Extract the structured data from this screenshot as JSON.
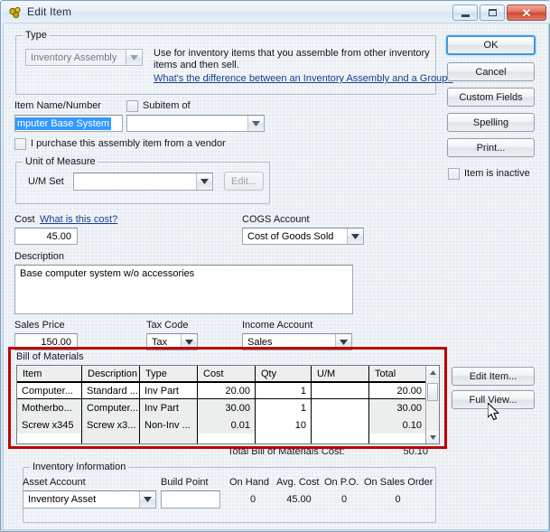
{
  "window": {
    "title": "Edit Item",
    "icon": "item-assembly-icon",
    "controls": {
      "minimize": "minimize-button",
      "maximize": "maximize-button",
      "close": "close-button",
      "close_glyph": "✕"
    }
  },
  "colors": {
    "annotation": "#c00000",
    "link": "#1a3c8c",
    "selection": "#3399ff",
    "dialog_bg": "#e8edf2"
  },
  "type_group": {
    "title": "Type",
    "selected": "Inventory Assembly",
    "help_text": "Use for inventory items that you assemble from other inventory items and then sell.",
    "link_text": "What's the difference between an Inventory Assembly and a Group?"
  },
  "item_name": {
    "label": "Item Name/Number",
    "value": "mputer Base System",
    "subitem_label": "Subitem of",
    "subitem_checked": false,
    "subitem_value": ""
  },
  "purchase_from_vendor": {
    "label": "I purchase this assembly item from a vendor",
    "checked": false
  },
  "unit_of_measure": {
    "title": "Unit of Measure",
    "label": "U/M Set",
    "value": "",
    "edit_button": "Edit..."
  },
  "cost": {
    "label": "Cost",
    "link_text": "What is this cost?",
    "value": "45.00"
  },
  "cogs": {
    "label": "COGS Account",
    "value": "Cost of Goods Sold"
  },
  "description": {
    "label": "Description",
    "value": "Base computer system w/o accessories"
  },
  "sales_price": {
    "label": "Sales Price",
    "value": "150.00"
  },
  "tax_code": {
    "label": "Tax Code",
    "value": "Tax"
  },
  "income_account": {
    "label": "Income Account",
    "value": "Sales"
  },
  "bom": {
    "title": "Bill of Materials",
    "columns": [
      "Item",
      "Description",
      "Type",
      "Cost",
      "Qty",
      "U/M",
      "Total"
    ],
    "rows": [
      {
        "item": "Computer...",
        "description": "Standard ...",
        "type": "Inv Part",
        "cost": "20.00",
        "qty": "1",
        "um": "",
        "total": "20.00"
      },
      {
        "item": "Motherbo...",
        "description": "Computer...",
        "type": "Inv Part",
        "cost": "30.00",
        "qty": "1",
        "um": "",
        "total": "30.00"
      },
      {
        "item": "Screw x345",
        "description": "Screw x3...",
        "type": "Non-Inv ...",
        "cost": "0.01",
        "qty": "10",
        "um": "",
        "total": "0.10"
      }
    ],
    "total_label": "Total Bill of Materials Cost:",
    "total_value": "50.10"
  },
  "inventory_information": {
    "title": "Inventory Information",
    "asset_account_label": "Asset Account",
    "asset_account_value": "Inventory Asset",
    "build_point_label": "Build Point",
    "build_point_value": "",
    "stats": [
      {
        "label": "On Hand",
        "value": "0"
      },
      {
        "label": "Avg. Cost",
        "value": "45.00"
      },
      {
        "label": "On P.O.",
        "value": "0"
      },
      {
        "label": "On Sales Order",
        "value": "0"
      }
    ]
  },
  "action_buttons": {
    "ok": "OK",
    "cancel": "Cancel",
    "custom_fields": "Custom Fields",
    "spelling": "Spelling",
    "print": "Print...",
    "item_is_inactive": "Item is inactive",
    "item_is_inactive_checked": false,
    "edit_item": "Edit Item...",
    "full_view": "Full View..."
  }
}
